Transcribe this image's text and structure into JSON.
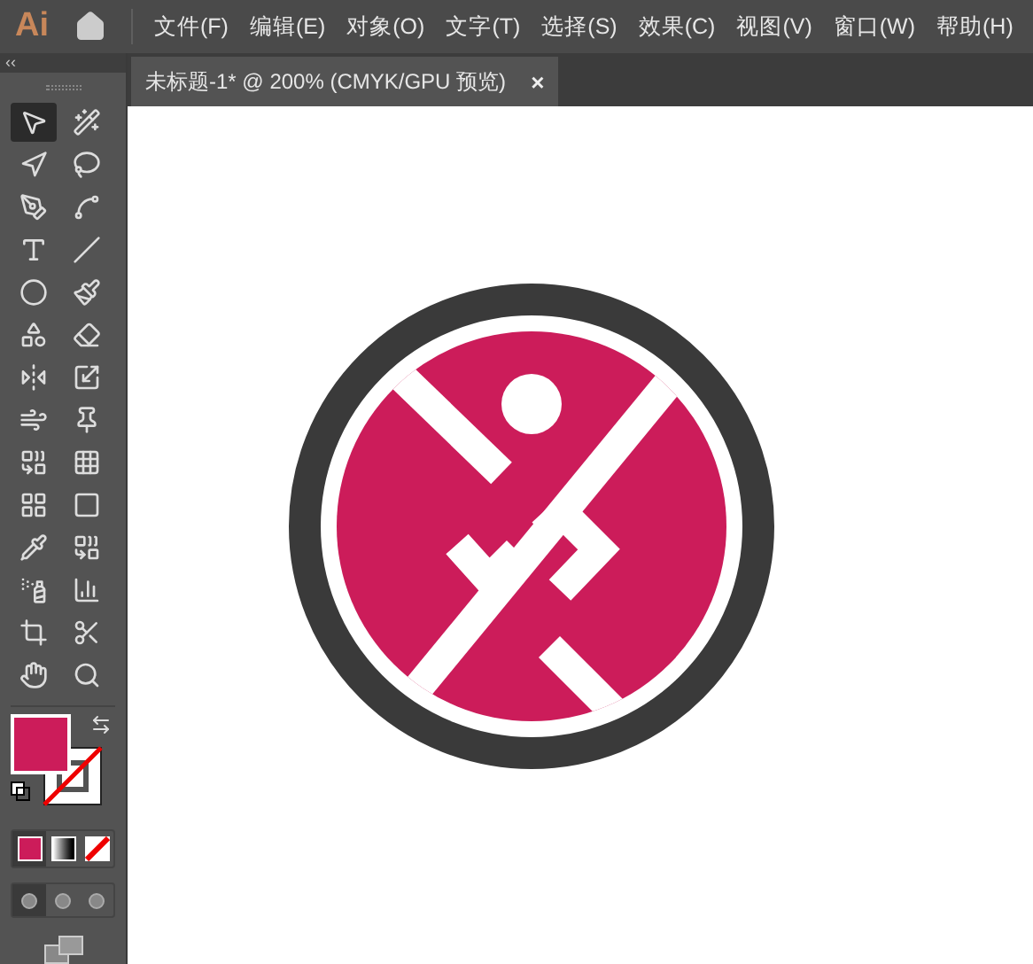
{
  "app": {
    "logo": "Ai"
  },
  "menu": [
    "文件(F)",
    "编辑(E)",
    "对象(O)",
    "文字(T)",
    "选择(S)",
    "效果(C)",
    "视图(V)",
    "窗口(W)",
    "帮助(H)"
  ],
  "panel_collapse": "‹‹",
  "document_tab": {
    "title": "未标题-1* @ 200% (CMYK/GPU 预览)",
    "close": "×",
    "selected": true
  },
  "tools": [
    {
      "kind": "select",
      "selected": true
    },
    {
      "kind": "wand",
      "selected": false
    },
    {
      "kind": "direct",
      "selected": false
    },
    {
      "kind": "lasso",
      "selected": false
    },
    {
      "kind": "pen",
      "selected": false
    },
    {
      "kind": "curvature",
      "selected": false
    },
    {
      "kind": "type",
      "selected": false
    },
    {
      "kind": "line",
      "selected": false
    },
    {
      "kind": "ellipse",
      "selected": false
    },
    {
      "kind": "brush",
      "selected": false
    },
    {
      "kind": "shaper",
      "selected": false
    },
    {
      "kind": "eraser",
      "selected": false
    },
    {
      "kind": "reflect",
      "selected": false
    },
    {
      "kind": "scale",
      "selected": false
    },
    {
      "kind": "warp",
      "selected": false
    },
    {
      "kind": "pin",
      "selected": false
    },
    {
      "kind": "shapebuilder",
      "selected": false
    },
    {
      "kind": "perspective",
      "selected": false
    },
    {
      "kind": "mesh",
      "selected": false
    },
    {
      "kind": "gradient",
      "selected": false
    },
    {
      "kind": "eyedropper",
      "selected": false
    },
    {
      "kind": "blend",
      "selected": false
    },
    {
      "kind": "spray",
      "selected": false
    },
    {
      "kind": "graph",
      "selected": false
    },
    {
      "kind": "artboard",
      "selected": false
    },
    {
      "kind": "slice",
      "selected": false
    },
    {
      "kind": "hand",
      "selected": false
    },
    {
      "kind": "zoom",
      "selected": false
    }
  ],
  "color_modes": [
    {
      "kind": "color",
      "selected": true
    },
    {
      "kind": "gradient",
      "selected": false
    },
    {
      "kind": "none",
      "selected": false
    }
  ],
  "draw_modes": [
    {
      "selected": true
    },
    {
      "selected": false
    },
    {
      "selected": false
    }
  ]
}
